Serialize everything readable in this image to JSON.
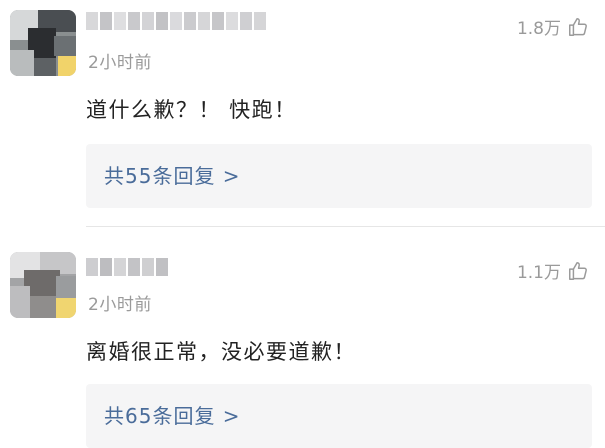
{
  "comments": [
    {
      "time": "2小时前",
      "likes": "1.8万",
      "text": "道什么歉？！ 快跑！",
      "replies": "共55条回复 >"
    },
    {
      "time": "2小时前",
      "likes": "1.1万",
      "text": "离婚很正常，没必要道歉！",
      "replies": "共65条回复 >"
    }
  ],
  "icons": {
    "like": "thumbs-up-icon"
  }
}
